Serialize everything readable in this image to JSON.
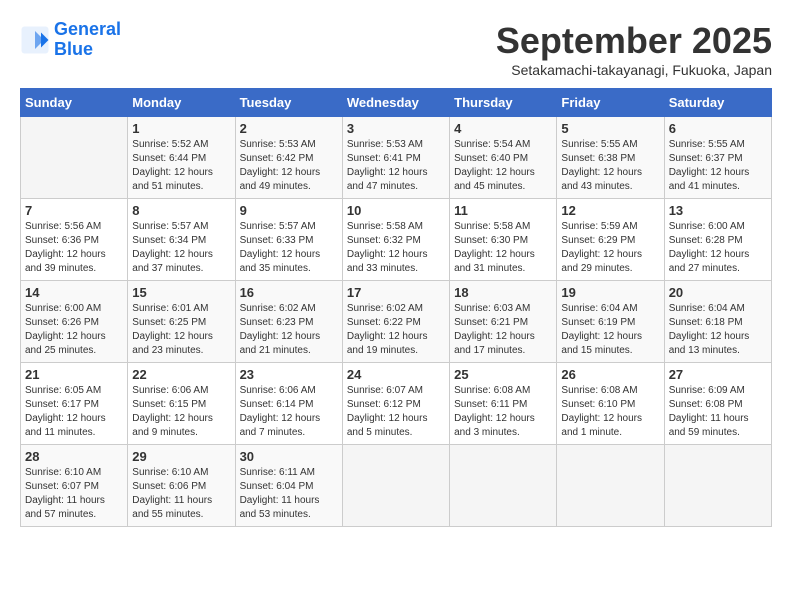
{
  "header": {
    "logo_line1": "General",
    "logo_line2": "Blue",
    "month_title": "September 2025",
    "location": "Setakamachi-takayanagi, Fukuoka, Japan"
  },
  "weekdays": [
    "Sunday",
    "Monday",
    "Tuesday",
    "Wednesday",
    "Thursday",
    "Friday",
    "Saturday"
  ],
  "weeks": [
    [
      {
        "day": "",
        "info": ""
      },
      {
        "day": "1",
        "info": "Sunrise: 5:52 AM\nSunset: 6:44 PM\nDaylight: 12 hours\nand 51 minutes."
      },
      {
        "day": "2",
        "info": "Sunrise: 5:53 AM\nSunset: 6:42 PM\nDaylight: 12 hours\nand 49 minutes."
      },
      {
        "day": "3",
        "info": "Sunrise: 5:53 AM\nSunset: 6:41 PM\nDaylight: 12 hours\nand 47 minutes."
      },
      {
        "day": "4",
        "info": "Sunrise: 5:54 AM\nSunset: 6:40 PM\nDaylight: 12 hours\nand 45 minutes."
      },
      {
        "day": "5",
        "info": "Sunrise: 5:55 AM\nSunset: 6:38 PM\nDaylight: 12 hours\nand 43 minutes."
      },
      {
        "day": "6",
        "info": "Sunrise: 5:55 AM\nSunset: 6:37 PM\nDaylight: 12 hours\nand 41 minutes."
      }
    ],
    [
      {
        "day": "7",
        "info": "Sunrise: 5:56 AM\nSunset: 6:36 PM\nDaylight: 12 hours\nand 39 minutes."
      },
      {
        "day": "8",
        "info": "Sunrise: 5:57 AM\nSunset: 6:34 PM\nDaylight: 12 hours\nand 37 minutes."
      },
      {
        "day": "9",
        "info": "Sunrise: 5:57 AM\nSunset: 6:33 PM\nDaylight: 12 hours\nand 35 minutes."
      },
      {
        "day": "10",
        "info": "Sunrise: 5:58 AM\nSunset: 6:32 PM\nDaylight: 12 hours\nand 33 minutes."
      },
      {
        "day": "11",
        "info": "Sunrise: 5:58 AM\nSunset: 6:30 PM\nDaylight: 12 hours\nand 31 minutes."
      },
      {
        "day": "12",
        "info": "Sunrise: 5:59 AM\nSunset: 6:29 PM\nDaylight: 12 hours\nand 29 minutes."
      },
      {
        "day": "13",
        "info": "Sunrise: 6:00 AM\nSunset: 6:28 PM\nDaylight: 12 hours\nand 27 minutes."
      }
    ],
    [
      {
        "day": "14",
        "info": "Sunrise: 6:00 AM\nSunset: 6:26 PM\nDaylight: 12 hours\nand 25 minutes."
      },
      {
        "day": "15",
        "info": "Sunrise: 6:01 AM\nSunset: 6:25 PM\nDaylight: 12 hours\nand 23 minutes."
      },
      {
        "day": "16",
        "info": "Sunrise: 6:02 AM\nSunset: 6:23 PM\nDaylight: 12 hours\nand 21 minutes."
      },
      {
        "day": "17",
        "info": "Sunrise: 6:02 AM\nSunset: 6:22 PM\nDaylight: 12 hours\nand 19 minutes."
      },
      {
        "day": "18",
        "info": "Sunrise: 6:03 AM\nSunset: 6:21 PM\nDaylight: 12 hours\nand 17 minutes."
      },
      {
        "day": "19",
        "info": "Sunrise: 6:04 AM\nSunset: 6:19 PM\nDaylight: 12 hours\nand 15 minutes."
      },
      {
        "day": "20",
        "info": "Sunrise: 6:04 AM\nSunset: 6:18 PM\nDaylight: 12 hours\nand 13 minutes."
      }
    ],
    [
      {
        "day": "21",
        "info": "Sunrise: 6:05 AM\nSunset: 6:17 PM\nDaylight: 12 hours\nand 11 minutes."
      },
      {
        "day": "22",
        "info": "Sunrise: 6:06 AM\nSunset: 6:15 PM\nDaylight: 12 hours\nand 9 minutes."
      },
      {
        "day": "23",
        "info": "Sunrise: 6:06 AM\nSunset: 6:14 PM\nDaylight: 12 hours\nand 7 minutes."
      },
      {
        "day": "24",
        "info": "Sunrise: 6:07 AM\nSunset: 6:12 PM\nDaylight: 12 hours\nand 5 minutes."
      },
      {
        "day": "25",
        "info": "Sunrise: 6:08 AM\nSunset: 6:11 PM\nDaylight: 12 hours\nand 3 minutes."
      },
      {
        "day": "26",
        "info": "Sunrise: 6:08 AM\nSunset: 6:10 PM\nDaylight: 12 hours\nand 1 minute."
      },
      {
        "day": "27",
        "info": "Sunrise: 6:09 AM\nSunset: 6:08 PM\nDaylight: 11 hours\nand 59 minutes."
      }
    ],
    [
      {
        "day": "28",
        "info": "Sunrise: 6:10 AM\nSunset: 6:07 PM\nDaylight: 11 hours\nand 57 minutes."
      },
      {
        "day": "29",
        "info": "Sunrise: 6:10 AM\nSunset: 6:06 PM\nDaylight: 11 hours\nand 55 minutes."
      },
      {
        "day": "30",
        "info": "Sunrise: 6:11 AM\nSunset: 6:04 PM\nDaylight: 11 hours\nand 53 minutes."
      },
      {
        "day": "",
        "info": ""
      },
      {
        "day": "",
        "info": ""
      },
      {
        "day": "",
        "info": ""
      },
      {
        "day": "",
        "info": ""
      }
    ]
  ]
}
